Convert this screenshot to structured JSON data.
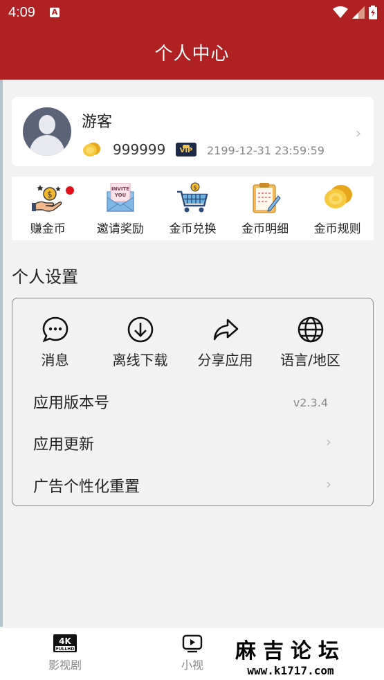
{
  "status_bar": {
    "time": "4:09",
    "notification_icon": "a-icon",
    "icons": [
      "wifi-icon",
      "signal-icon",
      "battery-icon"
    ]
  },
  "header": {
    "title": "个人中心"
  },
  "user": {
    "name": "游客",
    "coins": "999999",
    "vip_badge": "VIP",
    "expire": "2199-12-31 23:59:59"
  },
  "menu": [
    {
      "label": "赚金币",
      "icon": "earn-coins-icon",
      "has_dot": true
    },
    {
      "label": "邀请奖励",
      "icon": "invite-envelope-icon"
    },
    {
      "label": "金币兑换",
      "icon": "shopping-cart-icon"
    },
    {
      "label": "金币明细",
      "icon": "clipboard-icon"
    },
    {
      "label": "金币规则",
      "icon": "gold-coins-icon"
    }
  ],
  "invite_icon_text": "INVITE YOU",
  "settings": {
    "title": "个人设置",
    "quick": [
      {
        "label": "消息",
        "icon": "message-icon"
      },
      {
        "label": "离线下载",
        "icon": "download-icon"
      },
      {
        "label": "分享应用",
        "icon": "share-icon"
      },
      {
        "label": "语言/地区",
        "icon": "globe-icon"
      }
    ],
    "rows": {
      "version_label": "应用版本号",
      "version_value": "v2.3.4",
      "update_label": "应用更新",
      "ad_reset_label": "广告个性化重置"
    }
  },
  "bottom_nav": [
    {
      "label": "影视剧",
      "icon": "4k-fullhd-icon",
      "badge": "4K",
      "sub": "FULLHD"
    },
    {
      "label": "小视",
      "icon": "video-play-icon"
    }
  ],
  "watermark": {
    "line1": "麻吉论坛",
    "line2": "www.k1717.com"
  },
  "colors": {
    "primary": "#b02124",
    "background": "#f2f2f2"
  }
}
